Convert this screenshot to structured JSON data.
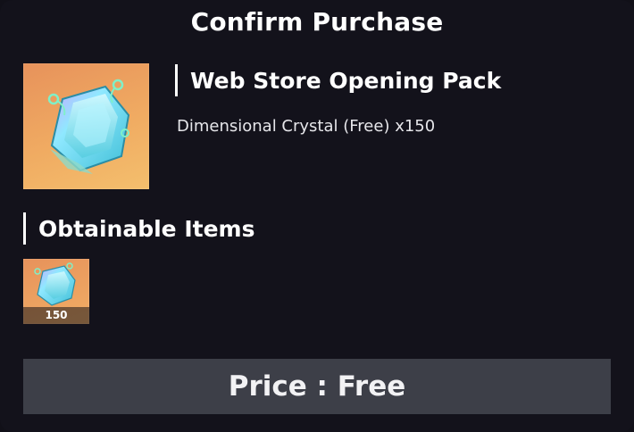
{
  "dialog": {
    "title": "Confirm Purchase"
  },
  "product": {
    "name": "Web Store Opening Pack",
    "description": "Dimensional Crystal (Free) x150",
    "icon": "dimensional-crystal-icon"
  },
  "obtainable": {
    "heading": "Obtainable Items",
    "items": [
      {
        "icon": "dimensional-crystal-icon",
        "quantity": "150"
      }
    ]
  },
  "purchase": {
    "price_label": "Price : Free"
  },
  "colors": {
    "background": "#13121b",
    "thumb_orange": "#ed9f5f",
    "button_bg": "#3d3f48",
    "crystal_cyan": "#7fe3f0"
  }
}
